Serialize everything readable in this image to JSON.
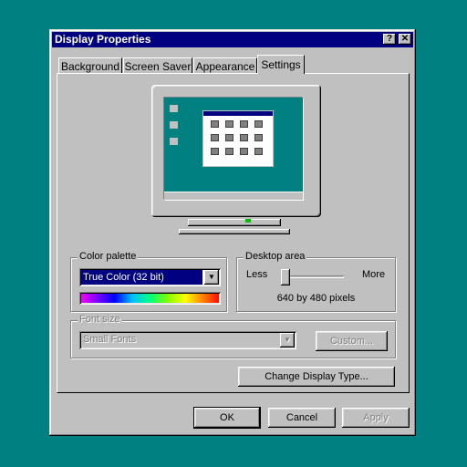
{
  "window": {
    "title": "Display Properties",
    "help_btn": "?",
    "close_btn": "✕"
  },
  "tabs": [
    {
      "label": "Background"
    },
    {
      "label": "Screen Saver"
    },
    {
      "label": "Appearance"
    },
    {
      "label": "Settings",
      "active": true
    }
  ],
  "color_palette": {
    "group_label": "Color palette",
    "selected": "True Color (32 bit)"
  },
  "desktop_area": {
    "group_label": "Desktop area",
    "less_label": "Less",
    "more_label": "More",
    "resolution_text": "640 by 480 pixels",
    "slider_position": 0.0
  },
  "font_size": {
    "group_label": "Font size",
    "selected": "Small Fonts",
    "custom_button": "Custom...",
    "enabled": false
  },
  "change_display_type_button": "Change Display Type...",
  "footer": {
    "ok": "OK",
    "cancel": "Cancel",
    "apply": "Apply"
  },
  "colors": {
    "desktop": "#008080",
    "titlebar": "#000080",
    "face": "#c0c0c0",
    "selection": "#000080"
  },
  "icons": [
    "help-icon",
    "close-icon",
    "dropdown-arrow-icon",
    "monitor-icon"
  ]
}
